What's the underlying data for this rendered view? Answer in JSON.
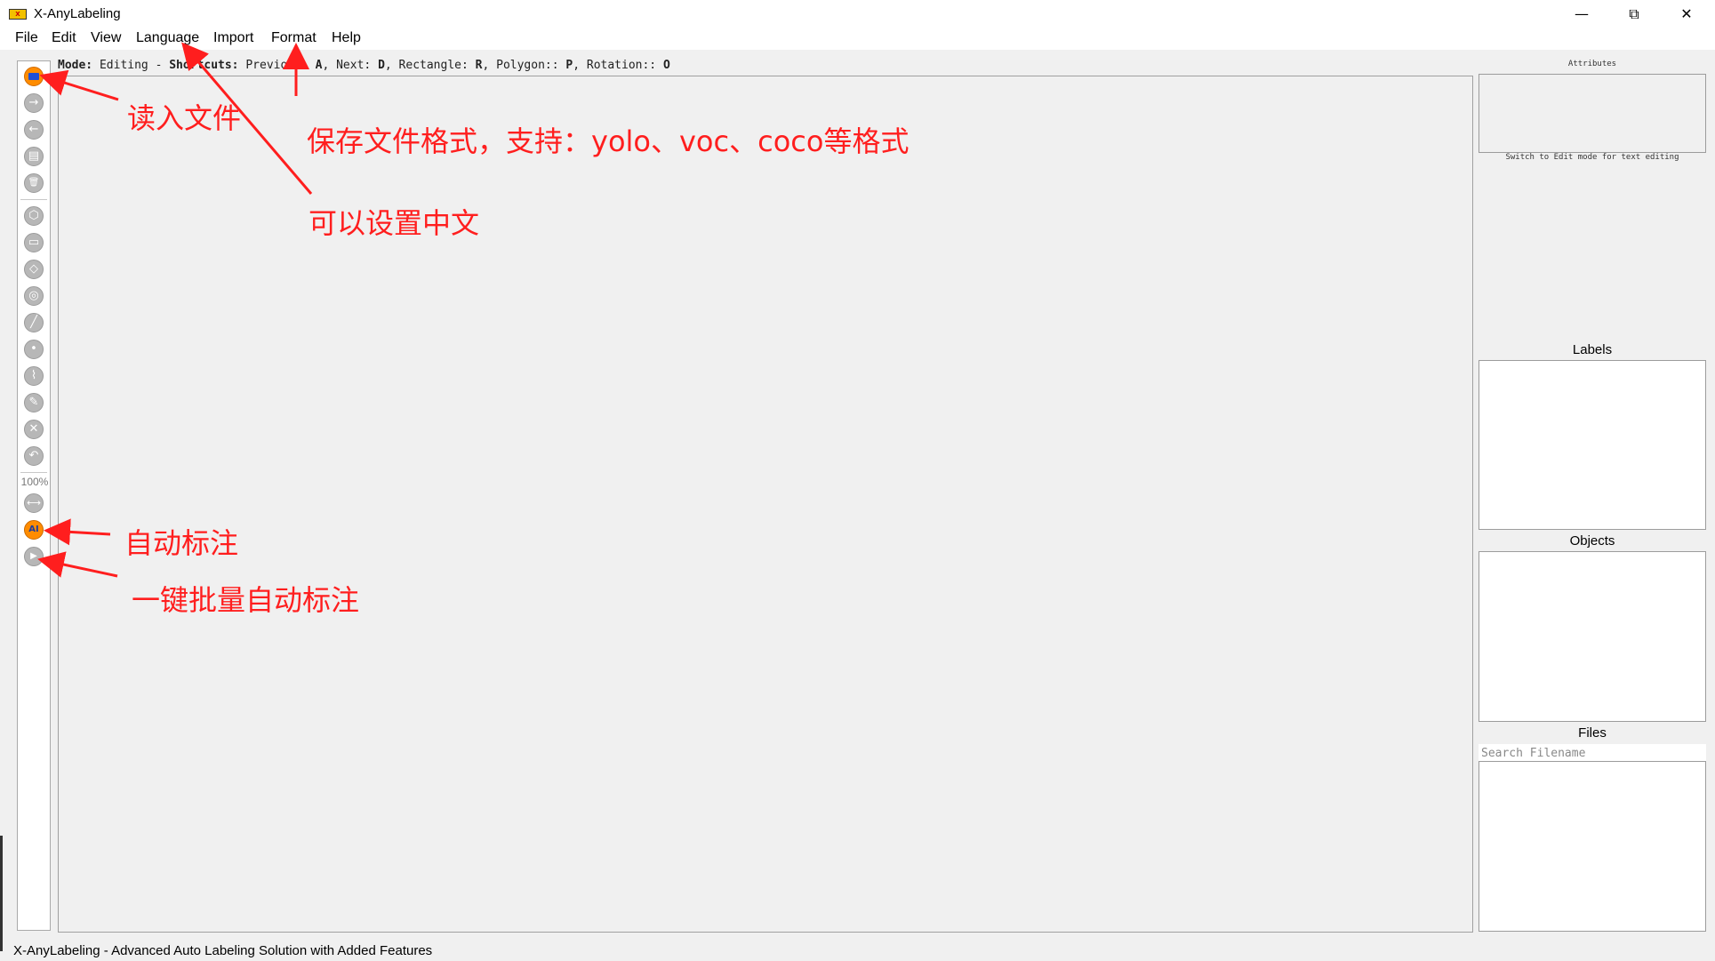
{
  "window": {
    "title": "X-AnyLabeling",
    "app_icon_text": "X",
    "controls": {
      "minimize": "—",
      "maximize": "⧉",
      "close": "✕"
    }
  },
  "menu": [
    {
      "label": "File"
    },
    {
      "label": "Edit"
    },
    {
      "label": "View"
    },
    {
      "label": "Language"
    },
    {
      "label": "Import"
    },
    {
      "label": "Format"
    },
    {
      "label": "Help"
    }
  ],
  "toolbar": {
    "tools": [
      {
        "name": "open-file-icon",
        "glyph": ""
      },
      {
        "name": "next-image-icon",
        "glyph": "→"
      },
      {
        "name": "prev-image-icon",
        "glyph": "←"
      },
      {
        "name": "save-icon",
        "glyph": "▤"
      },
      {
        "name": "delete-file-icon",
        "glyph": "🗑"
      },
      {
        "name": "create-polygon-icon",
        "glyph": "⬡"
      },
      {
        "name": "create-rectangle-icon",
        "glyph": "▭"
      },
      {
        "name": "create-rotation-icon",
        "glyph": "◇"
      },
      {
        "name": "create-circle-icon",
        "glyph": "◎"
      },
      {
        "name": "create-line-icon",
        "glyph": "╱"
      },
      {
        "name": "create-point-icon",
        "glyph": "•"
      },
      {
        "name": "create-linestrip-icon",
        "glyph": "⌇"
      },
      {
        "name": "edit-object-icon",
        "glyph": "✎"
      },
      {
        "name": "delete-object-icon",
        "glyph": "✕"
      },
      {
        "name": "undo-icon",
        "glyph": "↶"
      },
      {
        "name": "fit-width-icon",
        "glyph": "⟷"
      },
      {
        "name": "auto-label-ai-icon",
        "glyph": "AI"
      },
      {
        "name": "run-all-images-icon",
        "glyph": "▶"
      }
    ],
    "zoom": "100%"
  },
  "mode_bar": {
    "mode_label": "Mode:",
    "mode_value": " Editing - ",
    "shortcuts_label": "Shortcuts:",
    "previous_text": " Previous: ",
    "previous_key": "A",
    "next_text": ", Next: ",
    "next_key": "D",
    "rectangle_text": ", Rectangle: ",
    "rectangle_key": "R",
    "polygon_text": ", Polygon:: ",
    "polygon_key": "P",
    "rotation_text": ", Rotation:: ",
    "rotation_key": "O"
  },
  "dock": {
    "attributes_title": "Attributes",
    "attributes_hint": "Switch to Edit mode for text editing",
    "labels_title": "Labels",
    "objects_title": "Objects",
    "files_title": "Files",
    "search_placeholder": "Search Filename"
  },
  "status": "X-AnyLabeling - Advanced Auto Labeling Solution with Added Features",
  "annotations": {
    "open_file": "读入文件",
    "save_format": "保存文件格式，支持：yolo、voc、coco等格式",
    "language": "可以设置中文",
    "auto_label": "自动标注",
    "batch_auto_label": "一键批量自动标注"
  },
  "colors": {
    "annotation": "#ff1e1e",
    "accent_orange": "#ff8c00",
    "open_icon_blue": "#1e4fd6"
  }
}
